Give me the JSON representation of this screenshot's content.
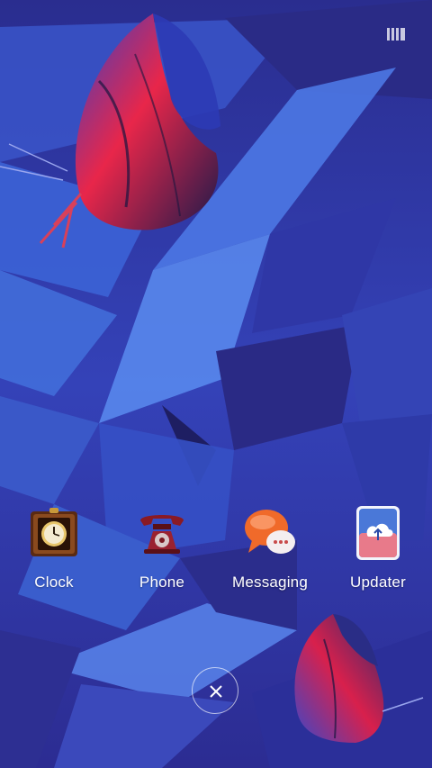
{
  "status_bar": {
    "icon": "tile-grid-icon"
  },
  "apps": [
    {
      "label": "Clock",
      "icon": "clock-icon"
    },
    {
      "label": "Phone",
      "icon": "phone-icon"
    },
    {
      "label": "Messaging",
      "icon": "messaging-icon"
    },
    {
      "label": "Updater",
      "icon": "updater-icon"
    }
  ],
  "close_button": {
    "icon": "close-icon"
  },
  "colors": {
    "wallpaper_base": "#2b2f9e",
    "wallpaper_light": "#4a7ae6",
    "butterfly_red": "#e8264a",
    "label_text": "#ffffff"
  }
}
